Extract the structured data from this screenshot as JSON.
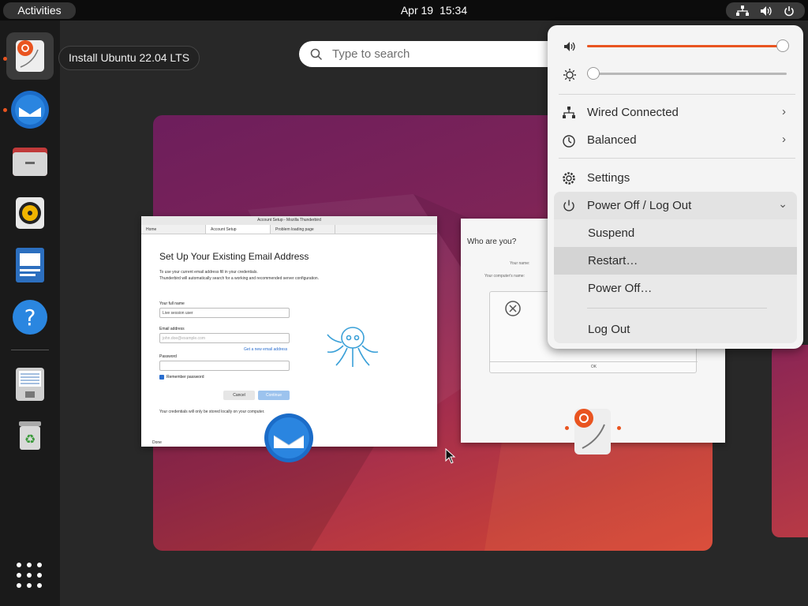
{
  "topbar": {
    "activities": "Activities",
    "date": "Apr 19",
    "time": "15:34"
  },
  "tooltip": "Install Ubuntu 22.04 LTS",
  "search": {
    "placeholder": "Type to search"
  },
  "dock": [
    {
      "name": "install-ubuntu",
      "icon": "ubuntu-installer-icon",
      "running": true,
      "selected": true
    },
    {
      "name": "thunderbird",
      "icon": "thunderbird-icon",
      "running": true
    },
    {
      "name": "files",
      "icon": "files-icon"
    },
    {
      "name": "rhythmbox",
      "icon": "rhythmbox-icon"
    },
    {
      "name": "libreoffice-writer",
      "icon": "libreoffice-writer-icon"
    },
    {
      "name": "help",
      "icon": "help-icon"
    },
    {
      "name": "disk-image-writer",
      "icon": "disk-icon"
    },
    {
      "name": "trash",
      "icon": "trash-icon"
    }
  ],
  "thunderbird_window": {
    "title": "Account Setup - Mozilla Thunderbird",
    "tabs": [
      "Home",
      "Account Setup",
      "Problem loading page"
    ],
    "heading": "Set Up Your Existing Email Address",
    "intro1": "To use your current email address fill in your credentials.",
    "intro2": "Thunderbird will automatically search for a working and recommended server configuration.",
    "fullname_label": "Your full name",
    "fullname_value": "Live session user",
    "email_label": "Email address",
    "email_placeholder": "john.doe@example.com",
    "new_email_link": "Get a new email address",
    "password_label": "Password",
    "remember": "Remember password",
    "cancel": "Cancel",
    "continue": "Continue",
    "footer": "Your credentials will only be stored locally on your computer.",
    "status": "Done"
  },
  "installer_window": {
    "heading": "Who are you?",
    "your_name": "Your name:",
    "computer_name": "Your computer's name:",
    "ok": "OK"
  },
  "quick_settings": {
    "volume": 0.98,
    "brightness": 0.03,
    "wired": "Wired Connected",
    "power_mode": "Balanced",
    "settings": "Settings",
    "power_section": "Power Off / Log Out",
    "suspend": "Suspend",
    "restart": "Restart…",
    "power_off": "Power Off…",
    "log_out": "Log Out"
  },
  "colors": {
    "accent": "#e95420",
    "menu_bg": "#f4f4f4",
    "highlight": "#d4d4d4"
  }
}
